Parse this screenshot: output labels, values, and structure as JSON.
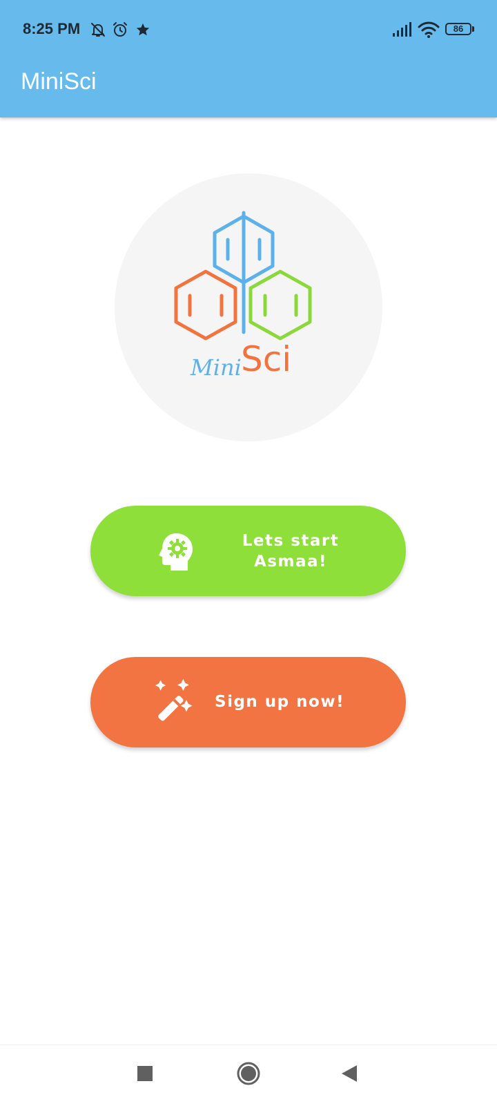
{
  "status_bar": {
    "time": "8:25 PM",
    "icons": [
      "bell-off-icon",
      "alarm-icon",
      "star-icon",
      "signal-icon",
      "wifi-icon",
      "battery-icon"
    ],
    "battery_level": "86"
  },
  "app_bar": {
    "title": "MiniSci",
    "color": "#66bbec"
  },
  "logo": {
    "text_mini": "Mini",
    "text_sci": "Sci",
    "colors": {
      "blue": "#5cb1ea",
      "orange": "#f1743f",
      "green": "#8ad83a"
    }
  },
  "buttons": {
    "start": {
      "label_line1": "Lets start",
      "label_line2": "Asmaa!",
      "icon": "head-gear-icon",
      "color": "#8fdf3b"
    },
    "signup": {
      "label": "Sign up now!",
      "icon": "magic-wand-icon",
      "color": "#f27442"
    }
  },
  "nav_bar": {
    "items": [
      "recents-square-icon",
      "home-circle-icon",
      "back-triangle-icon"
    ]
  }
}
